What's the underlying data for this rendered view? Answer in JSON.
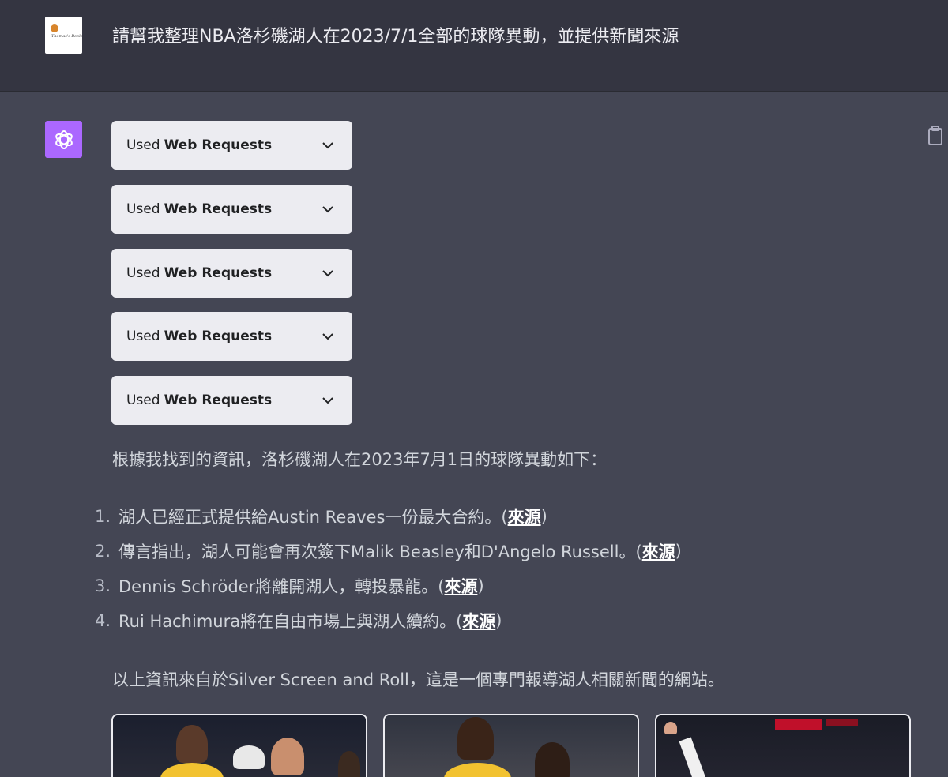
{
  "user_message": {
    "text": "請幫我整理NBA洛杉磯湖人在2023/7/1全部的球隊異動，並提供新聞來源",
    "avatar_caption": "Thomas's BookClub"
  },
  "assistant": {
    "avatar_icon": "openai-logo-icon",
    "copy_icon": "clipboard-icon",
    "tool_calls": [
      {
        "prefix": "Used",
        "name": "Web Requests"
      },
      {
        "prefix": "Used",
        "name": "Web Requests"
      },
      {
        "prefix": "Used",
        "name": "Web Requests"
      },
      {
        "prefix": "Used",
        "name": "Web Requests"
      },
      {
        "prefix": "Used",
        "name": "Web Requests"
      }
    ],
    "intro": "根據我找到的資訊，洛杉磯湖人在2023年7月1日的球隊異動如下：",
    "items": [
      {
        "num": "1.",
        "text": "湖人已經正式提供給Austin Reaves一份最大合約。(",
        "link": "來源",
        "close": ")"
      },
      {
        "num": "2.",
        "text": "傳言指出，湖人可能會再次簽下Malik Beasley和D'Angelo Russell。(",
        "link": "來源",
        "close": ")"
      },
      {
        "num": "3.",
        "text": "Dennis Schröder將離開湖人，轉投暴龍。(",
        "link": "來源",
        "close": ")"
      },
      {
        "num": "4.",
        "text": "Rui Hachimura將在自由市場上與湖人續約。(",
        "link": "來源",
        "close": ")"
      }
    ],
    "outro": "以上資訊來自於Silver Screen and Roll，這是一個專門報導湖人相關新聞的網站。"
  },
  "colors": {
    "user_bg": "#343541",
    "assistant_bg": "#444654",
    "avatar_purple": "#ab68ff",
    "button_bg": "#ececf1"
  }
}
